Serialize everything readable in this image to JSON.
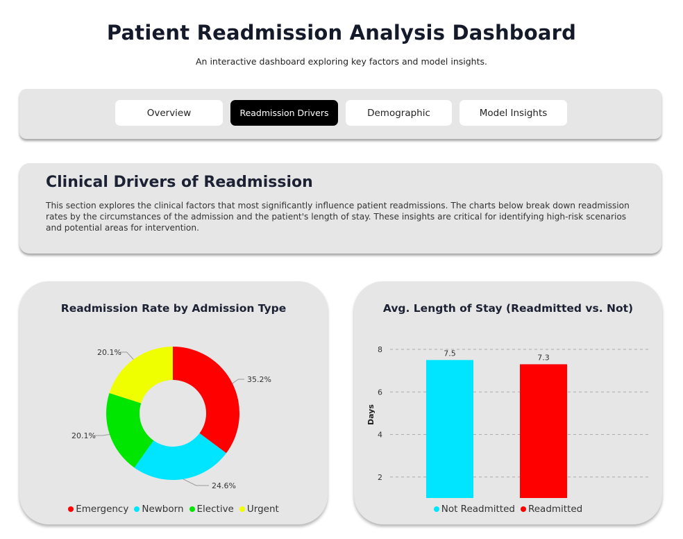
{
  "header": {
    "title": "Patient Readmission Analysis Dashboard",
    "subtitle": "An interactive dashboard exploring key factors and model insights."
  },
  "nav": {
    "tabs": [
      {
        "label": "Overview",
        "active": false
      },
      {
        "label": "Readmission Drivers",
        "active": true
      },
      {
        "label": "Demographic",
        "active": false
      },
      {
        "label": "Model Insights",
        "active": false
      }
    ]
  },
  "intro": {
    "title": "Clinical Drivers of Readmission",
    "text": "This section explores the clinical factors that most significantly influence patient readmissions. The charts below break down readmission rates by the circumstances of the admission and the patient's length of stay. These insights are critical for identifying high-risk scenarios and potential areas for intervention."
  },
  "colors": {
    "emergency": "#ff0000",
    "newborn": "#00e5ff",
    "elective": "#00e600",
    "urgent": "#f0ff00",
    "not_readmitted": "#00e5ff",
    "readmitted": "#ff0000"
  },
  "chart_data": [
    {
      "type": "pie",
      "title": "Readmission Rate by Admission Type",
      "donut": true,
      "categories": [
        "Emergency",
        "Newborn",
        "Elective",
        "Urgent"
      ],
      "values": [
        35.2,
        24.6,
        20.1,
        20.1
      ],
      "labels": [
        "35.2%",
        "24.6%",
        "20.1%",
        "20.1%"
      ],
      "legend": "bottom"
    },
    {
      "type": "bar",
      "title": "Avg. Length of Stay (Readmitted vs. Not)",
      "categories": [
        "Not Readmitted",
        "Readmitted"
      ],
      "values": [
        7.5,
        7.3
      ],
      "data_labels": [
        "7.5",
        "7.3"
      ],
      "ylabel": "Days",
      "yticks": [
        2,
        4,
        6,
        8
      ],
      "ylim": [
        0,
        8.5
      ],
      "grid": true,
      "legend": "bottom"
    }
  ]
}
